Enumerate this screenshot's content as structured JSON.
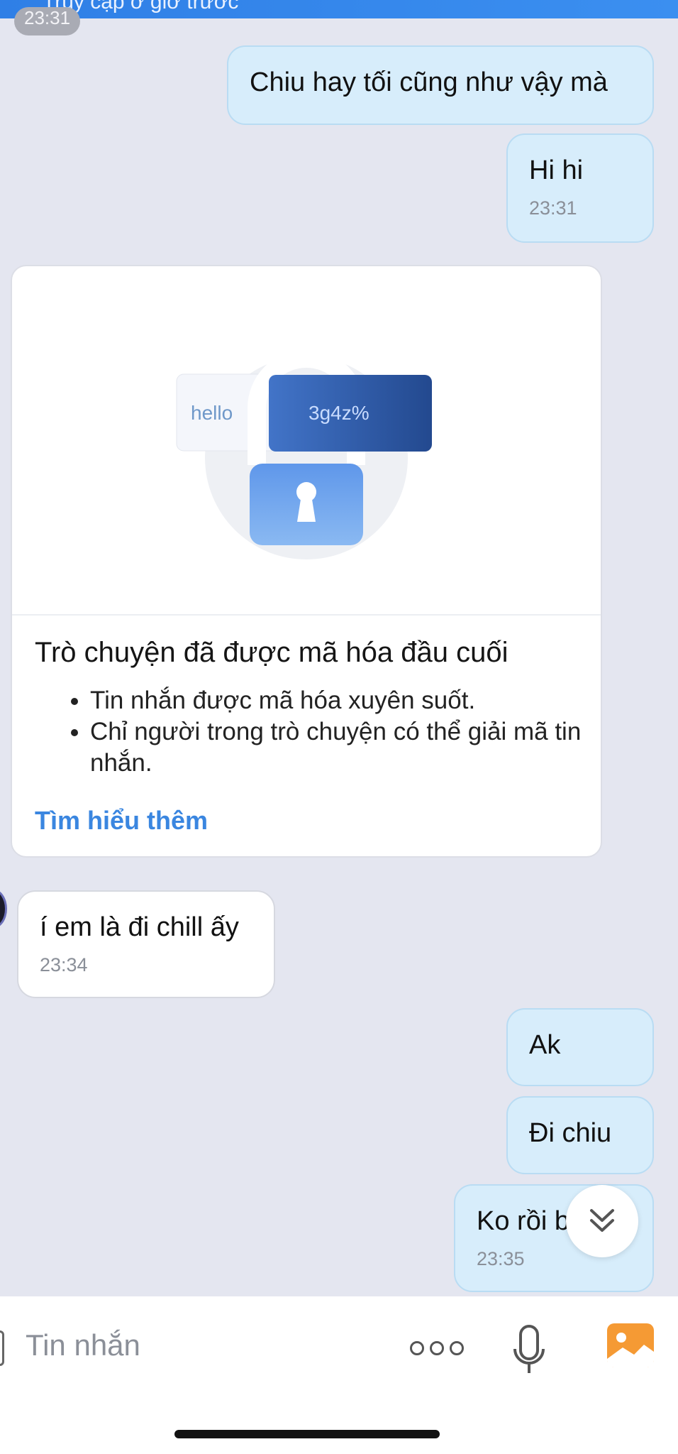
{
  "header": {
    "status_text": "Truy cập ở giờ trước",
    "time_chip": "23:31"
  },
  "messages": [
    {
      "dir": "out",
      "text": "Chiu hay tối cũng như vậy mà",
      "time": ""
    },
    {
      "dir": "out",
      "text": "Hi hi",
      "time": "23:31"
    },
    {
      "dir": "in",
      "text": "í em là đi chill ấy",
      "time": "23:34"
    },
    {
      "dir": "out",
      "text": "Ak",
      "time": ""
    },
    {
      "dir": "out",
      "text": "Đi chiu",
      "time": ""
    },
    {
      "dir": "out",
      "text": "Ko rồi b",
      "time": "23:35"
    }
  ],
  "encryption_card": {
    "illus_left": "hello",
    "illus_right": "3g4z%",
    "title": "Trò chuyện đã được mã hóa đầu cuối",
    "bullets": [
      "Tin nhắn được mã hóa xuyên suốt.",
      "Chỉ người trong trò chuyện có thể giải mã tin nhắn."
    ],
    "link": "Tìm hiểu thêm"
  },
  "composer": {
    "placeholder": "Tin nhắn"
  },
  "icons": {
    "scroll": "chevron-double-down-icon",
    "more": "more-dots-icon",
    "mic": "microphone-icon",
    "image": "image-icon"
  },
  "colors": {
    "outgoing_bubble": "#d7edfb",
    "incoming_bubble": "#ffffff",
    "link": "#3a86e0",
    "background": "#e4e6f0"
  }
}
